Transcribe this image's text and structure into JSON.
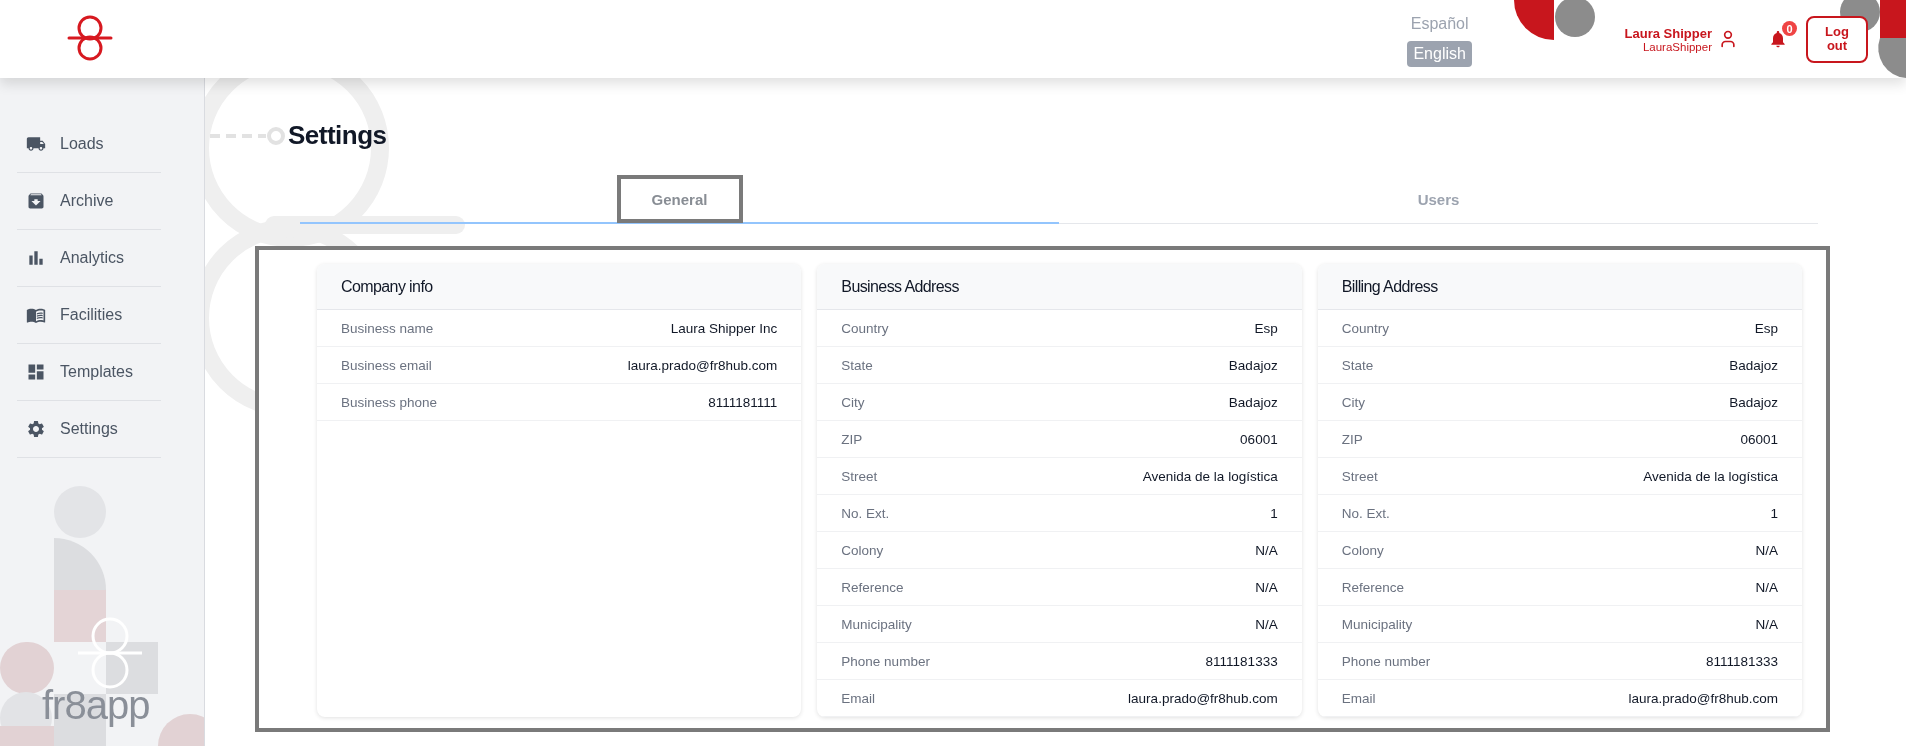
{
  "header": {
    "languages": [
      {
        "label": "Español",
        "selected": false
      },
      {
        "label": "English",
        "selected": true
      }
    ],
    "user": {
      "name": "Laura Shipper",
      "username": "LauraShipper"
    },
    "notifications": {
      "count": "0"
    },
    "logout_button": "Log out"
  },
  "sidebar": {
    "items": [
      {
        "label": "Loads"
      },
      {
        "label": "Archive"
      },
      {
        "label": "Analytics"
      },
      {
        "label": "Facilities"
      },
      {
        "label": "Templates"
      },
      {
        "label": "Settings"
      }
    ],
    "brand": "fr8app"
  },
  "page": {
    "title": "Settings",
    "tabs": [
      {
        "label": "General",
        "selected": true
      },
      {
        "label": "Users",
        "selected": false
      }
    ],
    "cards": [
      {
        "title": "Company info",
        "rows": [
          {
            "label": "Business name",
            "value": "Laura Shipper Inc"
          },
          {
            "label": "Business email",
            "value": "laura.prado@fr8hub.com"
          },
          {
            "label": "Business phone",
            "value": "8111181111"
          }
        ]
      },
      {
        "title": "Business Address",
        "rows": [
          {
            "label": "Country",
            "value": "Esp"
          },
          {
            "label": "State",
            "value": "Badajoz"
          },
          {
            "label": "City",
            "value": "Badajoz"
          },
          {
            "label": "ZIP",
            "value": "06001"
          },
          {
            "label": "Street",
            "value": "Avenida de la logística"
          },
          {
            "label": "No. Ext.",
            "value": "1"
          },
          {
            "label": "Colony",
            "value": "N/A"
          },
          {
            "label": "Reference",
            "value": "N/A"
          },
          {
            "label": "Municipality",
            "value": "N/A"
          },
          {
            "label": "Phone number",
            "value": "8111181333"
          },
          {
            "label": "Email",
            "value": "laura.prado@fr8hub.com"
          }
        ]
      },
      {
        "title": "Billing Address",
        "rows": [
          {
            "label": "Country",
            "value": "Esp"
          },
          {
            "label": "State",
            "value": "Badajoz"
          },
          {
            "label": "City",
            "value": "Badajoz"
          },
          {
            "label": "ZIP",
            "value": "06001"
          },
          {
            "label": "Street",
            "value": "Avenida de la logística"
          },
          {
            "label": "No. Ext.",
            "value": "1"
          },
          {
            "label": "Colony",
            "value": "N/A"
          },
          {
            "label": "Reference",
            "value": "N/A"
          },
          {
            "label": "Municipality",
            "value": "N/A"
          },
          {
            "label": "Phone number",
            "value": "8111181333"
          },
          {
            "label": "Email",
            "value": "laura.prado@fr8hub.com"
          }
        ]
      }
    ]
  }
}
